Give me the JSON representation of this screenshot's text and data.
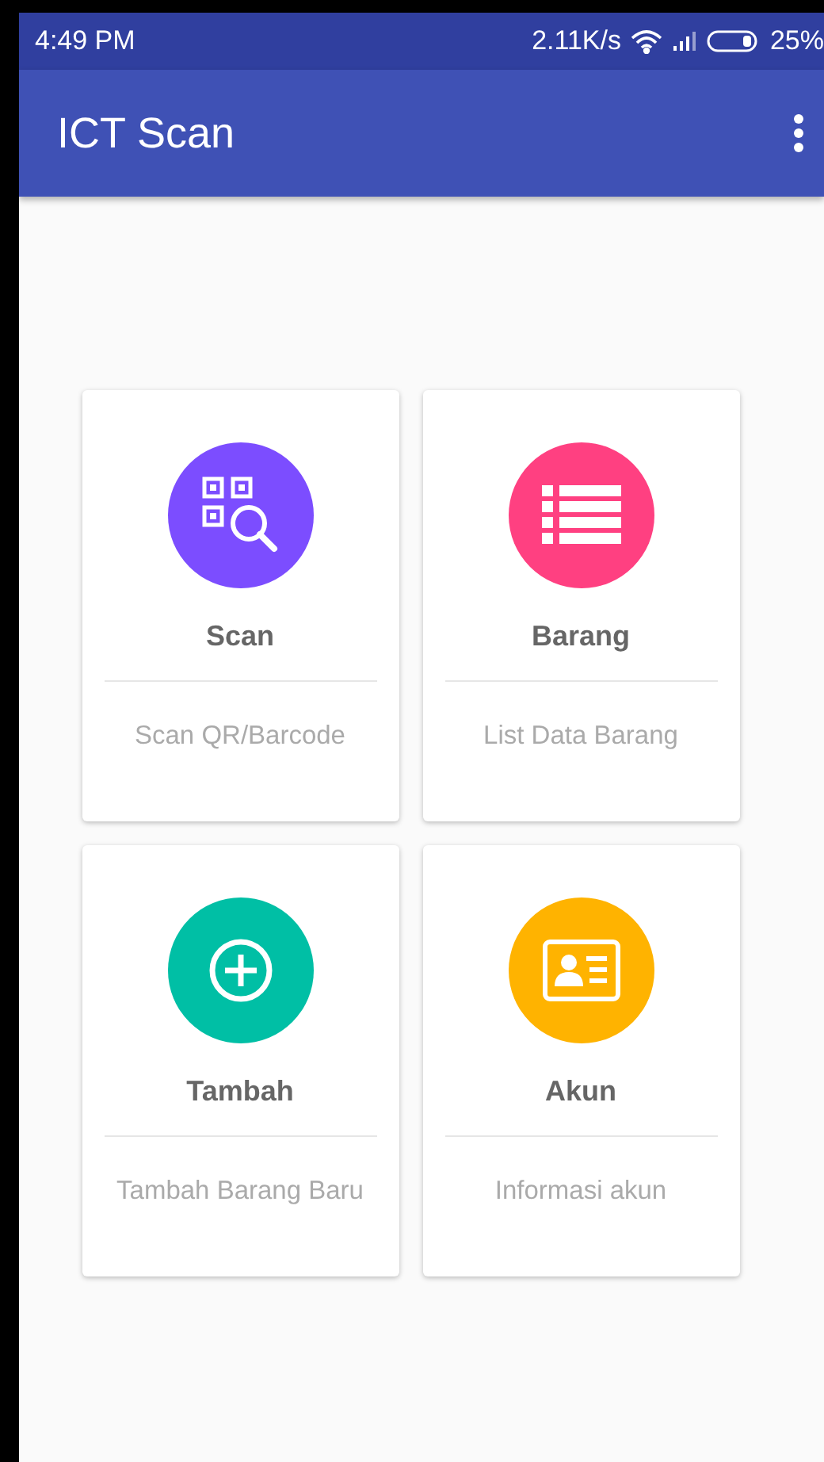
{
  "status_bar": {
    "time": "4:49 PM",
    "speed": "2.11K/s",
    "battery": "25%"
  },
  "app_bar": {
    "title": "ICT Scan"
  },
  "menu_cards": [
    {
      "kind": "qr-search",
      "title": "Scan",
      "subtitle": "Scan QR/Barcode",
      "color": "#7c4dff"
    },
    {
      "kind": "list",
      "title": "Barang",
      "subtitle": "List Data Barang",
      "color": "#ff4081"
    },
    {
      "kind": "add",
      "title": "Tambah",
      "subtitle": "Tambah Barang Baru",
      "color": "#00bfa5"
    },
    {
      "kind": "id-card",
      "title": "Akun",
      "subtitle": "Informasi akun",
      "color": "#ffb300"
    }
  ]
}
